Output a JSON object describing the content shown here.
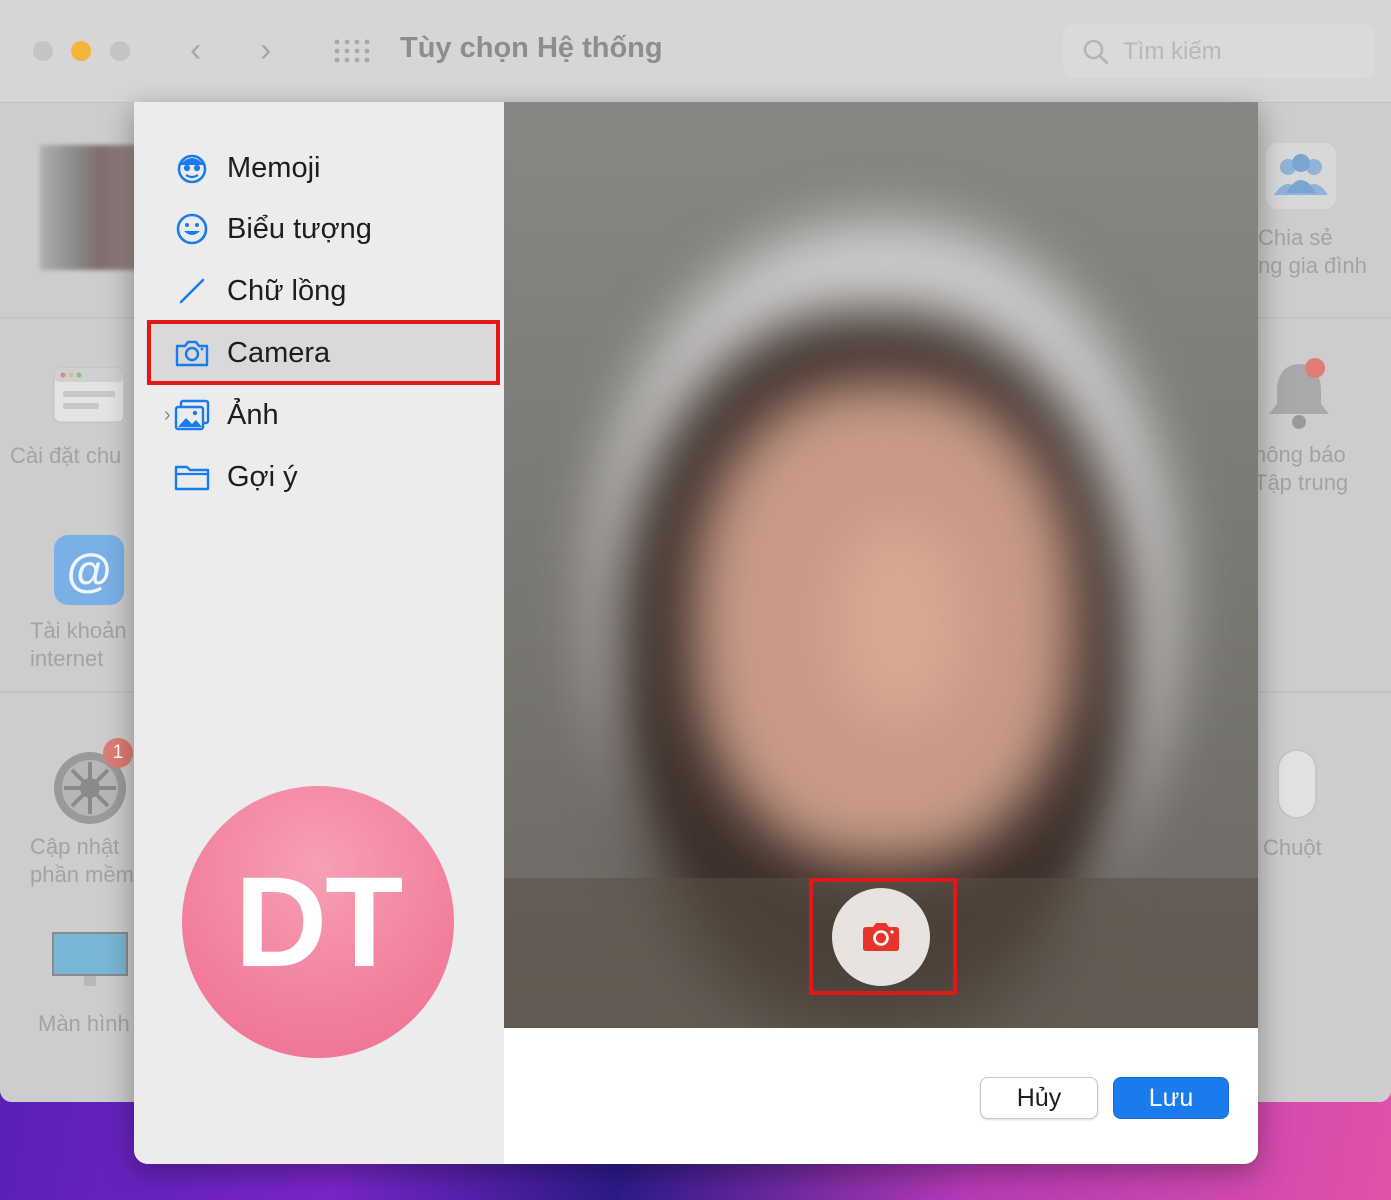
{
  "window": {
    "title": "Tùy chọn Hệ thống",
    "search_placeholder": "Tìm kiếm"
  },
  "background_prefs": {
    "left": [
      {
        "label": "Cài đặt chu",
        "icon": "general-settings-icon"
      },
      {
        "label": "Tài khoản\ninternet",
        "icon": "internet-accounts-icon"
      },
      {
        "label": "Cập nhật\nphần mềm",
        "icon": "software-update-icon",
        "badge": "1"
      },
      {
        "label": "Màn hình",
        "icon": "display-icon"
      }
    ],
    "right": [
      {
        "label": "Chia sẻ\nng gia đình",
        "icon": "family-sharing-icon"
      },
      {
        "label": "hông báo\nTập trung",
        "icon": "notifications-icon"
      },
      {
        "label": "Chuột",
        "icon": "mouse-icon"
      }
    ]
  },
  "sidebar": {
    "items": [
      {
        "label": "Memoji",
        "icon": "memoji-icon"
      },
      {
        "label": "Biểu tượng",
        "icon": "emoji-icon"
      },
      {
        "label": "Chữ lồng",
        "icon": "pencil-icon"
      },
      {
        "label": "Camera",
        "icon": "camera-icon",
        "selected": true
      },
      {
        "label": "Ảnh",
        "icon": "photos-icon",
        "expandable": true
      },
      {
        "label": "Gợi ý",
        "icon": "folder-icon"
      }
    ]
  },
  "avatar": {
    "initials": "DT"
  },
  "buttons": {
    "cancel": "Hủy",
    "save": "Lưu"
  },
  "colors": {
    "accent": "#1a7bef",
    "highlight": "#e01818",
    "monogram": "#f2809c",
    "shutter_icon": "#e8352b"
  }
}
